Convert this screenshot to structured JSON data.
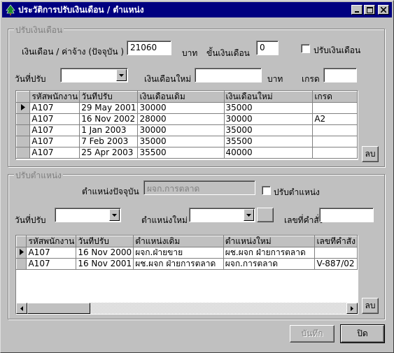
{
  "window": {
    "title": "ประวัติการปรับเงินเดือน / ตำแหน่ง",
    "icon": "app-tree-icon",
    "controls": [
      "minimize-icon",
      "maximize-icon",
      "close-icon"
    ]
  },
  "salary": {
    "group_title": "ปรับเงินเดือน",
    "current_label": "เงินเดือน / ค่าจ้าง  (ปัจจุบัน )",
    "current_value": "21060",
    "unit_baht": "บาท",
    "step_label": "ขั้นเงินเดือน",
    "step_value": "0",
    "adjust_checkbox_label": "ปรับเงินเดือน",
    "adjust_date_label": "วันที่ปรับ",
    "adjust_date_value": "",
    "new_salary_label": "เงินเดือนใหม่",
    "new_salary_value": "",
    "unit_baht_2": "บาท",
    "grade_label": "เกรด",
    "grade_value": "",
    "delete_button": "ลบ",
    "columns": [
      "รหัสพนักงาน",
      "วันที่ปรับ",
      "เงินเดือนเดิม",
      "เงินเดือนใหม่",
      "เกรด"
    ],
    "rows": [
      [
        "A107",
        "29 May 2001",
        "30000",
        "35000",
        ""
      ],
      [
        "A107",
        "16 Nov 2002",
        "28000",
        "30000",
        "A2"
      ],
      [
        "A107",
        "1 Jan 2003",
        "30000",
        "35000",
        ""
      ],
      [
        "A107",
        "7 Feb 2003",
        "35000",
        "35500",
        ""
      ],
      [
        "A107",
        "25 Apr 2003",
        "35500",
        "40000",
        ""
      ]
    ],
    "current_row_index": 0
  },
  "position": {
    "group_title": "ปรับตำแหน่ง",
    "current_label": "ตำแหน่งปัจจุบัน",
    "current_value": "ผจก.การตลาด",
    "adjust_checkbox_label": "ปรับตำแหน่ง",
    "adjust_date_label": "วันที่ปรับ",
    "adjust_date_value": "",
    "new_position_label": "ตำแหน่งใหม่",
    "new_position_value": "",
    "order_no_label": "เลขที่คำสั่ง",
    "order_no_value": "",
    "delete_button": "ลบ",
    "columns": [
      "รหัสพนักงาน",
      "วันที่ปรับ",
      "ตำแหน่งเดิม",
      "ตำแหน่งใหม่",
      "เลขที่คำสั่ง"
    ],
    "rows": [
      [
        "A107",
        "16 Nov 2000",
        "ผจก.ฝ่ายขาย",
        "ผช.ผจก ฝ่ายการตลาด",
        ""
      ],
      [
        "A107",
        "16 Nov 2001",
        "ผช.ผจก ฝ่ายการตลาด",
        "ผจก.การตลาด",
        "V-887/02"
      ]
    ],
    "current_row_index": 0
  },
  "footer": {
    "save_button": "บันทึก",
    "close_button": "ปิด"
  },
  "colors": {
    "titlebar": "#000080",
    "face": "#c0c0c0"
  }
}
